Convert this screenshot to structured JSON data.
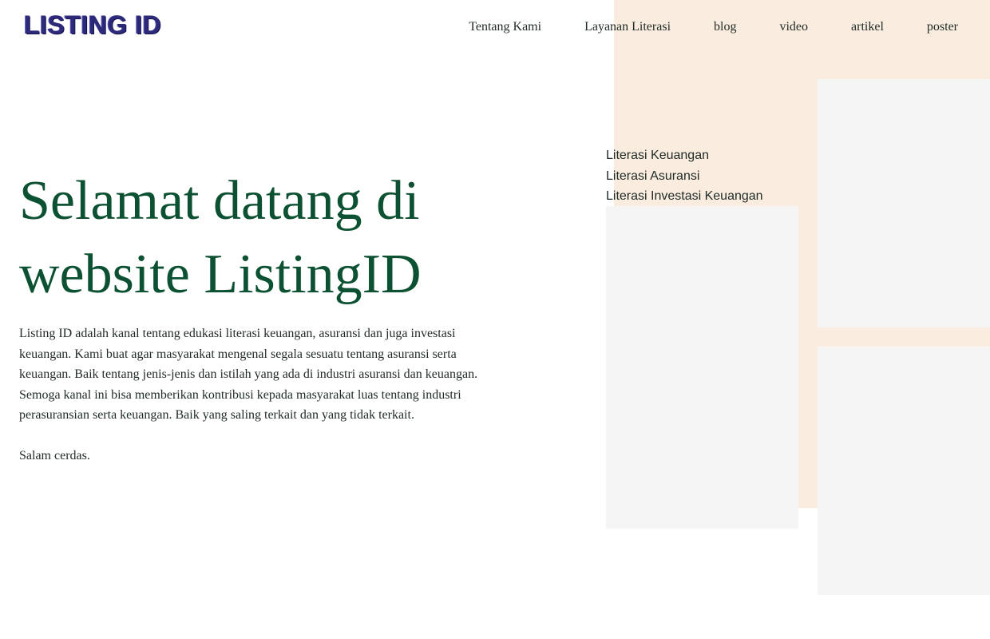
{
  "logo": {
    "text": "LISTING ID"
  },
  "nav": {
    "items": [
      "Tentang Kami",
      "Layanan Literasi",
      "blog",
      "video",
      "artikel",
      "poster"
    ]
  },
  "hero": {
    "title": "Selamat datang di website ListingID",
    "description": "Listing ID adalah kanal tentang edukasi literasi keuangan, asuransi dan juga investasi keuangan. Kami buat agar masyarakat mengenal segala sesuatu tentang asuransi serta keuangan. Baik tentang jenis-jenis dan istilah yang ada di industri asuransi dan keuangan. Semoga kanal ini bisa memberikan kontribusi kepada masyarakat luas tentang industri perasuransian serta keuangan. Baik yang saling terkait dan yang tidak terkait.",
    "closing": "Salam cerdas."
  },
  "literasi": {
    "items": [
      "Literasi Keuangan",
      "Literasi Asuransi",
      "Literasi Investasi Keuangan"
    ]
  },
  "colors": {
    "heading": "#0c5132",
    "text": "#1f2a26",
    "peach_accent": "#faede0",
    "placeholder": "#f5f5f5",
    "logo": "#2e2a7a"
  }
}
